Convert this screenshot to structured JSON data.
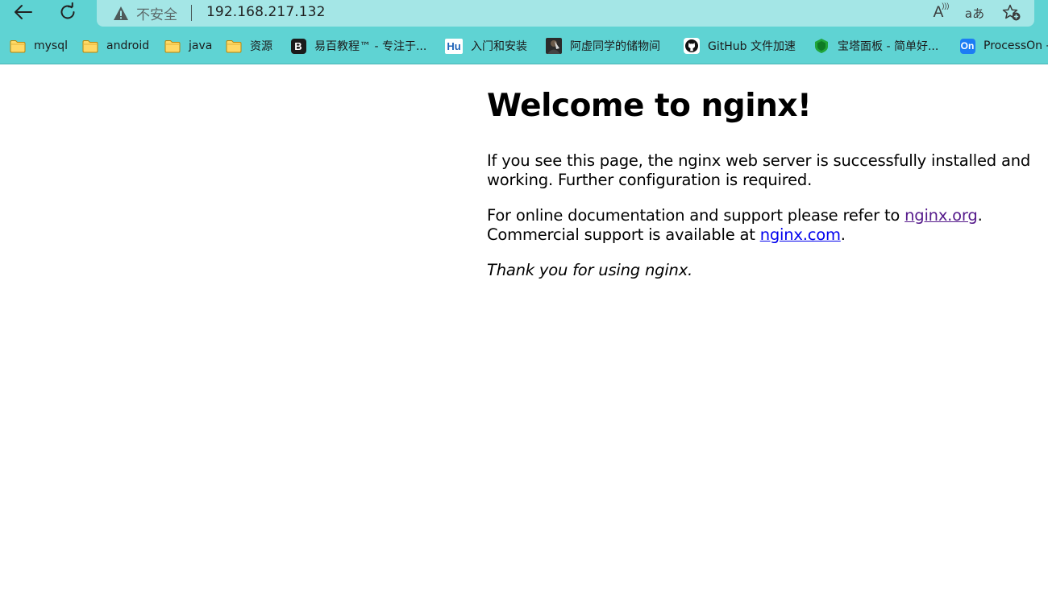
{
  "toolbar": {
    "back_icon": "back-arrow-icon",
    "refresh_icon": "refresh-icon"
  },
  "address_bar": {
    "security_icon": "warning-triangle-icon",
    "security_label": "不安全",
    "url": "192.168.217.132",
    "read_aloud_icon": "read-aloud-icon",
    "read_aloud_glyph": "A",
    "translate_icon": "translate-icon",
    "translate_glyph": "aあ",
    "favorite_icon": "add-favorite-star-icon"
  },
  "bookmarks": [
    {
      "label": "mysql",
      "icon": "folder-icon"
    },
    {
      "label": "android",
      "icon": "folder-icon"
    },
    {
      "label": "java",
      "icon": "folder-icon"
    },
    {
      "label": "资源",
      "icon": "folder-icon"
    },
    {
      "label": "易百教程™ - 专注于...",
      "icon": "yiibai-icon",
      "icon_text": "B"
    },
    {
      "label": "入门和安装",
      "icon": "hu-icon",
      "icon_text": "Hu"
    },
    {
      "label": "阿虚同学的储物间",
      "icon": "avatar-icon"
    },
    {
      "label": "GitHub 文件加速",
      "icon": "github-icon"
    },
    {
      "label": "宝塔面板 - 简单好...",
      "icon": "bt-panel-icon"
    },
    {
      "label": "ProcessOn -",
      "icon": "processon-icon",
      "icon_text": "On"
    }
  ],
  "page": {
    "title": "Welcome to nginx!",
    "p1": "If you see this page, the nginx web server is successfully installed and working. Further configuration is required.",
    "p2_before": "For online documentation and support please refer to ",
    "p2_link1": "nginx.org",
    "p2_after_link1": ".",
    "p2_line2": "Commercial support is available at ",
    "p2_link2": "nginx.com",
    "p2_after_link2": ".",
    "p3": "Thank you for using nginx."
  },
  "colors": {
    "toolbar_bg": "#5fd3d3",
    "address_bg": "#a4e6e6",
    "visited_link": "#551a8b",
    "link": "#0000ee"
  }
}
